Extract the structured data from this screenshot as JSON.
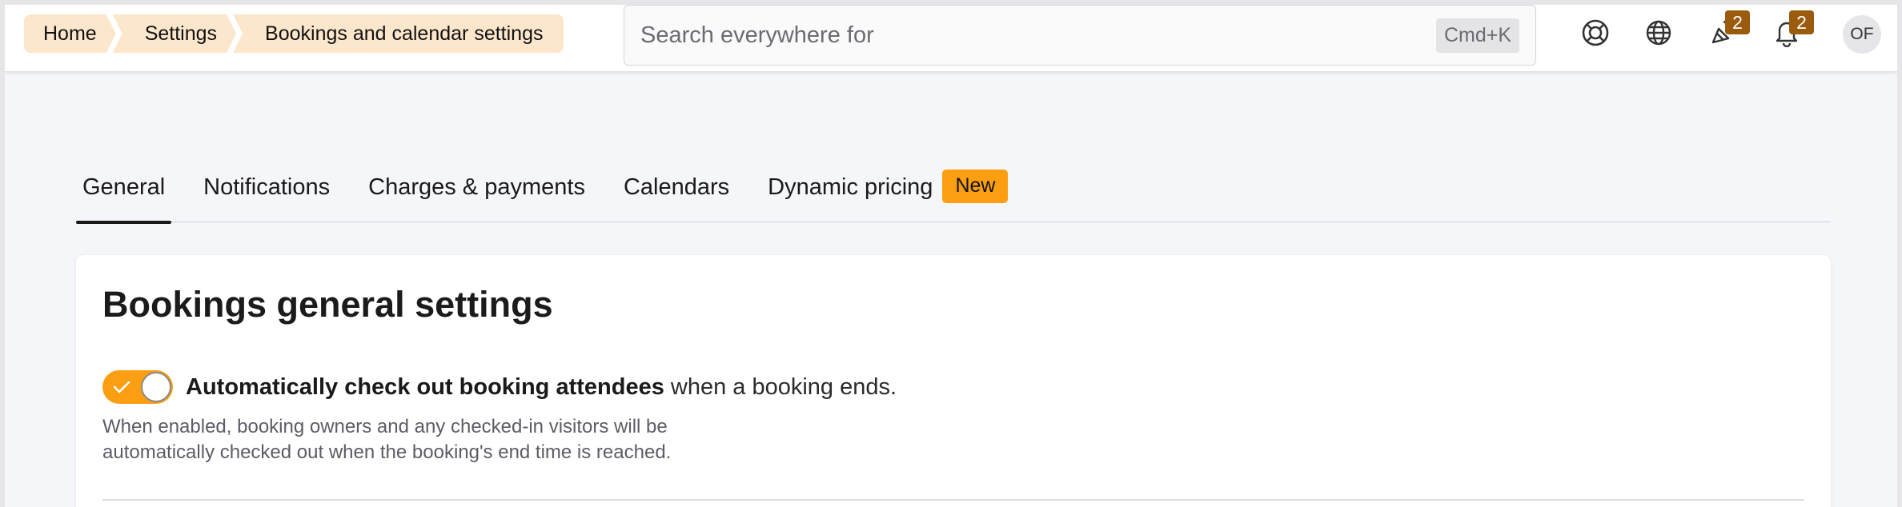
{
  "breadcrumb": [
    "Home",
    "Settings",
    "Bookings and calendar settings"
  ],
  "search": {
    "placeholder": "Search everywhere for",
    "shortcut": "Cmd+K"
  },
  "header": {
    "help_icon": "lifebuoy-icon",
    "language_icon": "globe-icon",
    "announcements_icon": "megaphone-icon",
    "announcements_count": "2",
    "notifications_icon": "bell-icon",
    "notifications_count": "2",
    "avatar_initials": "OF"
  },
  "tabs": [
    {
      "label": "General",
      "active": true
    },
    {
      "label": "Notifications"
    },
    {
      "label": "Charges & payments"
    },
    {
      "label": "Calendars"
    },
    {
      "label": "Dynamic pricing",
      "badge": "New"
    }
  ],
  "card": {
    "title": "Bookings general settings",
    "toggle": {
      "checked": true,
      "label_bold": "Automatically check out booking attendees",
      "label_rest": " when a booking ends.",
      "help_line1": "When enabled, booking owners and any checked-in visitors will be",
      "help_line2": "automatically checked out when the booking's end time is reached."
    }
  },
  "colors": {
    "accent": "#fb9e12",
    "breadcrumb_bg": "#fde7cc",
    "badge_bg": "#9a5b0c"
  }
}
